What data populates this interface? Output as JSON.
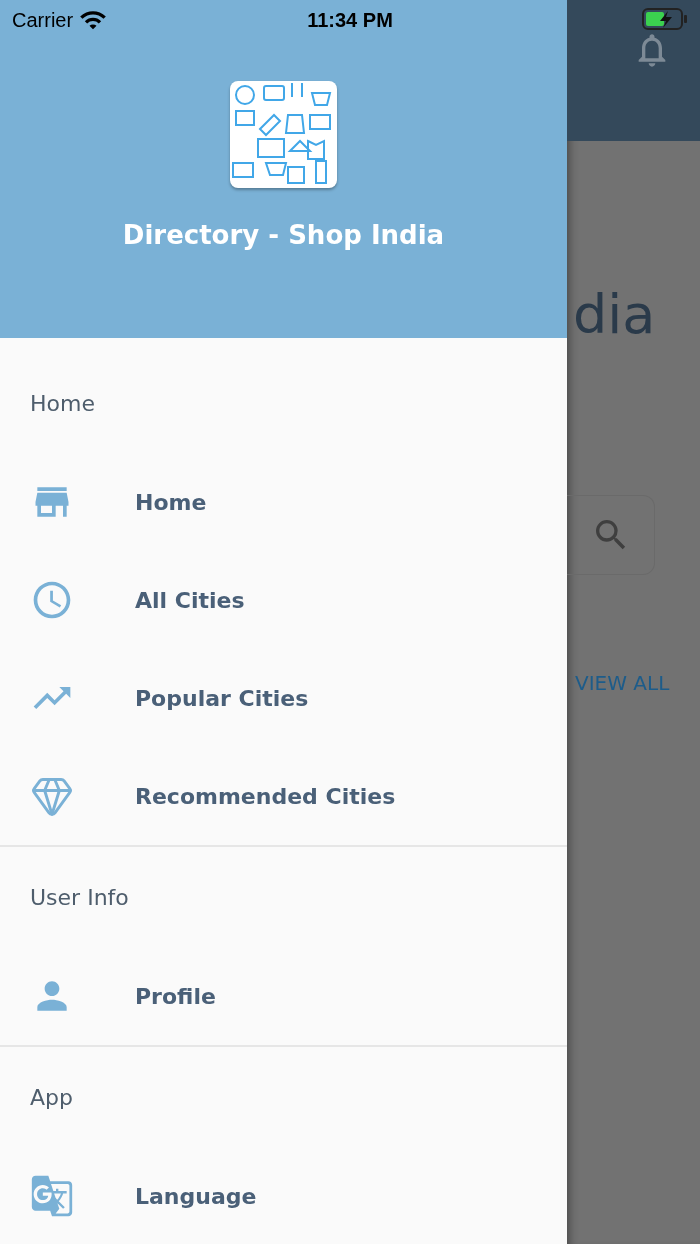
{
  "status_bar": {
    "carrier": "Carrier",
    "time": "11:34 PM"
  },
  "drawer": {
    "title": "Directory - Shop India",
    "sections": [
      {
        "title": "Home",
        "items": [
          {
            "label": "Home",
            "kind": "store"
          },
          {
            "label": "All Cities",
            "kind": "clock"
          },
          {
            "label": "Popular Cities",
            "kind": "trending"
          },
          {
            "label": "Recommended Cities",
            "kind": "diamond"
          }
        ]
      },
      {
        "title": "User Info",
        "items": [
          {
            "label": "Profile",
            "kind": "person"
          }
        ]
      },
      {
        "title": "App",
        "items": [
          {
            "label": "Language",
            "kind": "translate"
          }
        ]
      }
    ]
  },
  "background": {
    "heading": "dia",
    "link": "VIEW ALL"
  }
}
